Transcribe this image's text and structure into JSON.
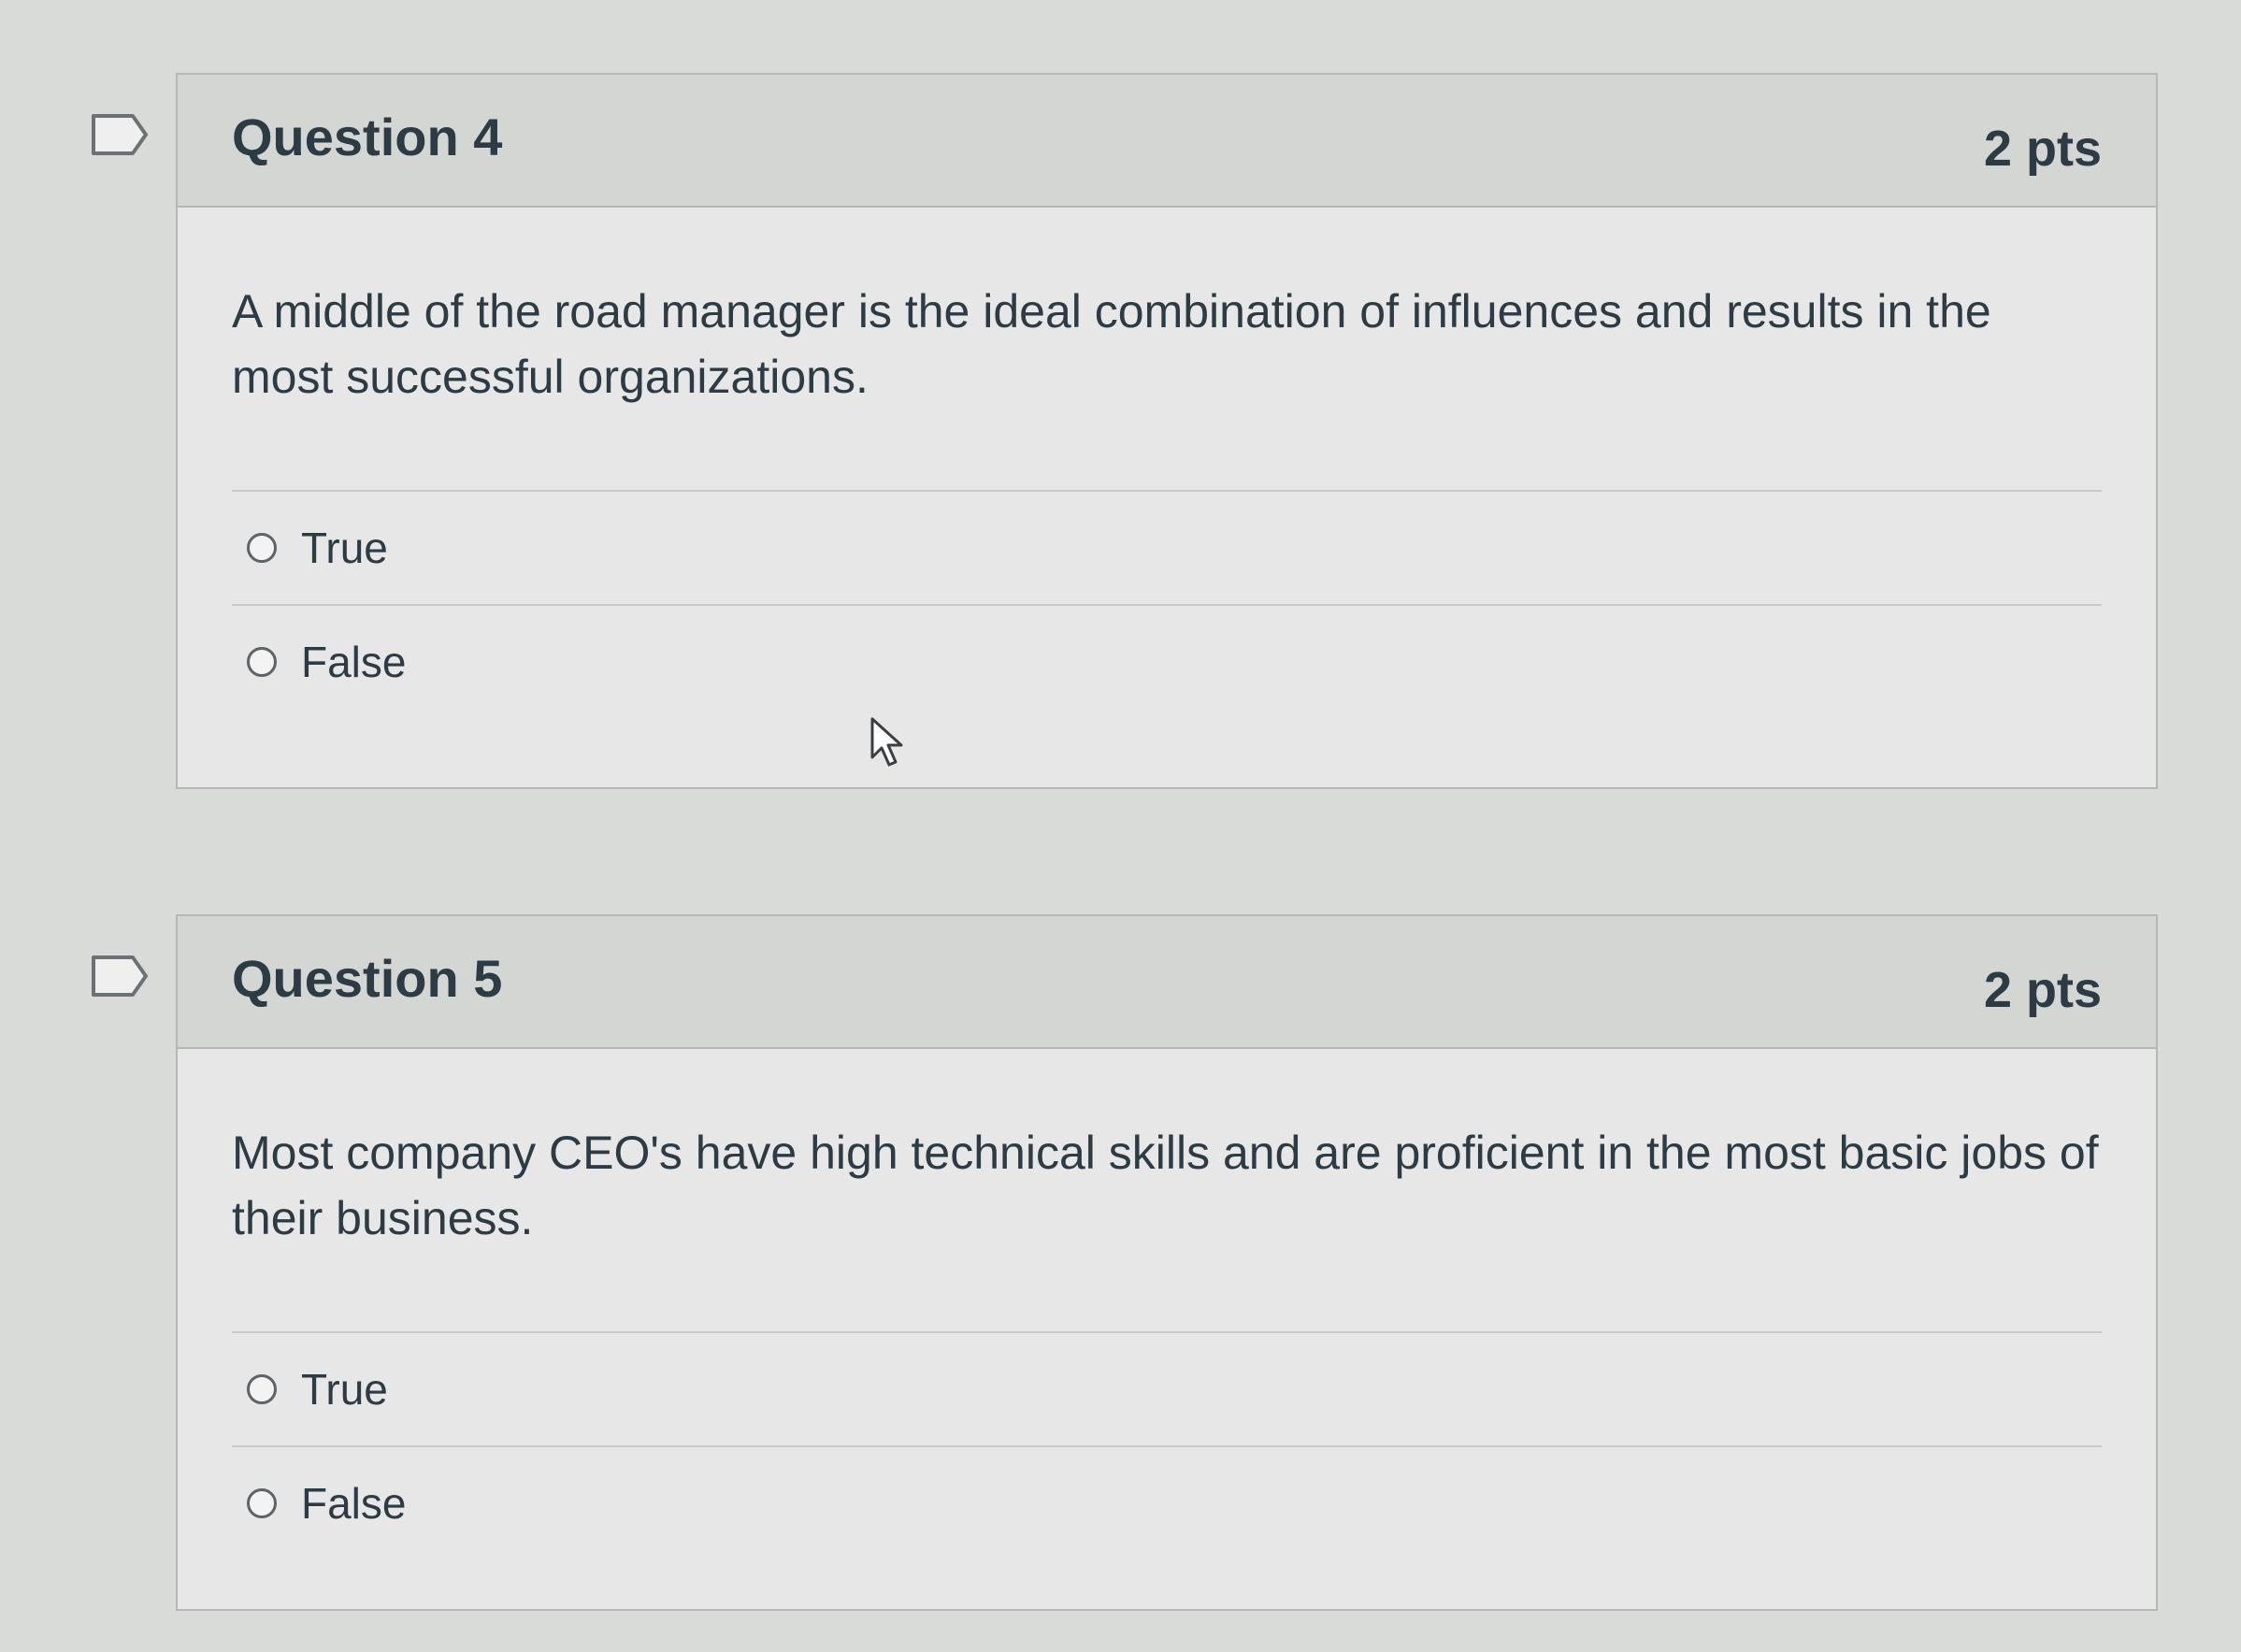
{
  "questions": [
    {
      "title": "Question 4",
      "points": "2 pts",
      "text": "A middle of the road manager is the ideal combination of influences and results in the most successful organizations.",
      "answers": [
        {
          "label": "True",
          "selected": false
        },
        {
          "label": "False",
          "selected": false
        }
      ],
      "flagged": false
    },
    {
      "title": "Question 5",
      "points": "2 pts",
      "text": "Most company CEO's have high technical skills and are proficient in the most basic jobs of their business.",
      "answers": [
        {
          "label": "True",
          "selected": false
        },
        {
          "label": "False",
          "selected": false
        }
      ],
      "flagged": false
    }
  ],
  "icons": {
    "flag": "flag-outline-icon",
    "radio": "radio-unchecked-icon",
    "cursor": "mouse-pointer-icon"
  },
  "colors": {
    "background": "#d9dbd9",
    "card": "#e6e7e6",
    "header": "#d4d6d4",
    "border": "#b5b8b6",
    "text": "#2d3b45"
  }
}
